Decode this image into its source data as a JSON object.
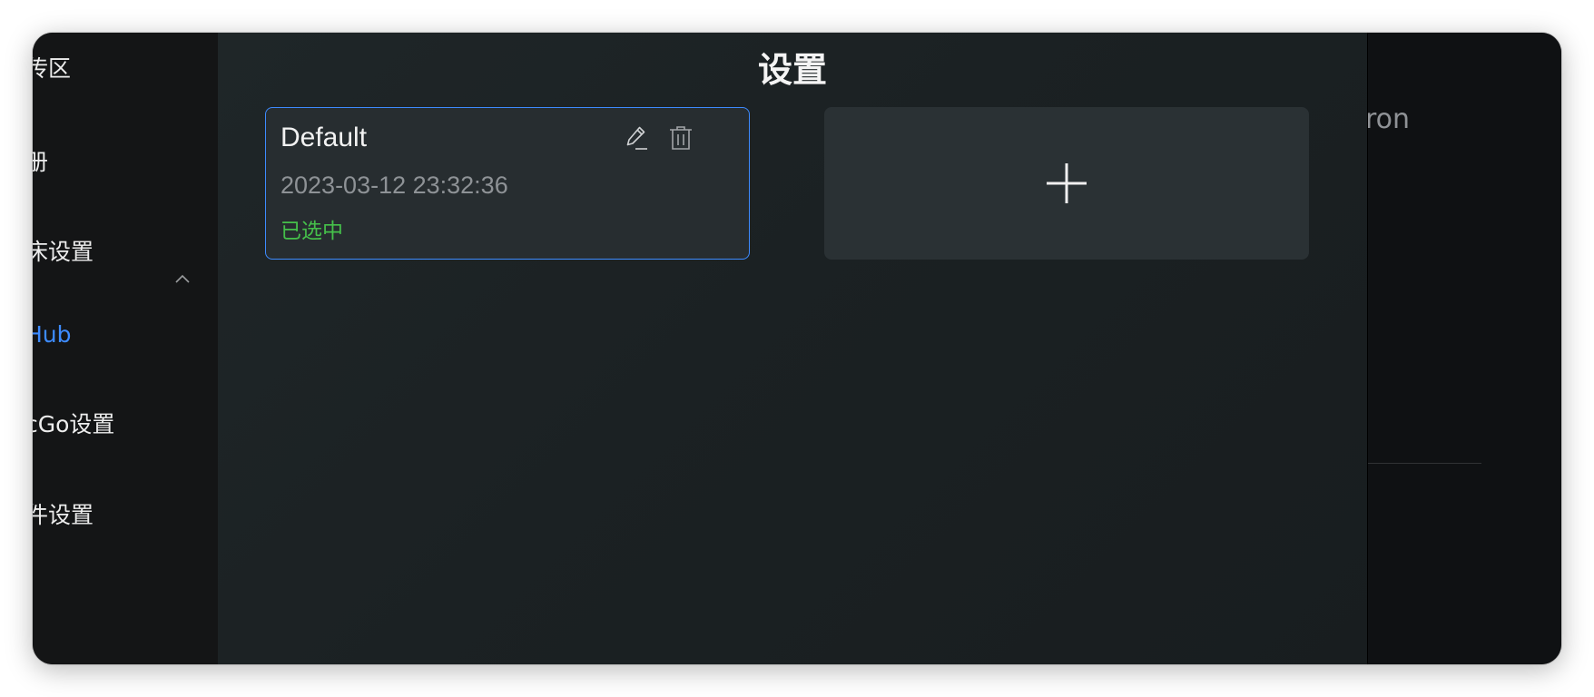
{
  "sidebar": {
    "items": [
      {
        "label": "传区"
      },
      {
        "label": "册"
      },
      {
        "label": "床设置"
      },
      {
        "label": "Hub"
      },
      {
        "label": "cGo设置"
      },
      {
        "label": "件设置"
      }
    ],
    "expanded_icon": "chevron-up-icon",
    "active_color": "#3d8bff"
  },
  "dialog": {
    "title": "设置",
    "config_card": {
      "name": "Default",
      "timestamp": "2023-03-12 23:32:36",
      "status": "已选中",
      "edit_icon": "pencil-icon",
      "delete_icon": "trash-icon",
      "border_color": "#3d8bff",
      "status_color": "#45c04a"
    },
    "add_card": {
      "icon": "plus-icon"
    }
  },
  "background": {
    "right_text": "ron"
  }
}
